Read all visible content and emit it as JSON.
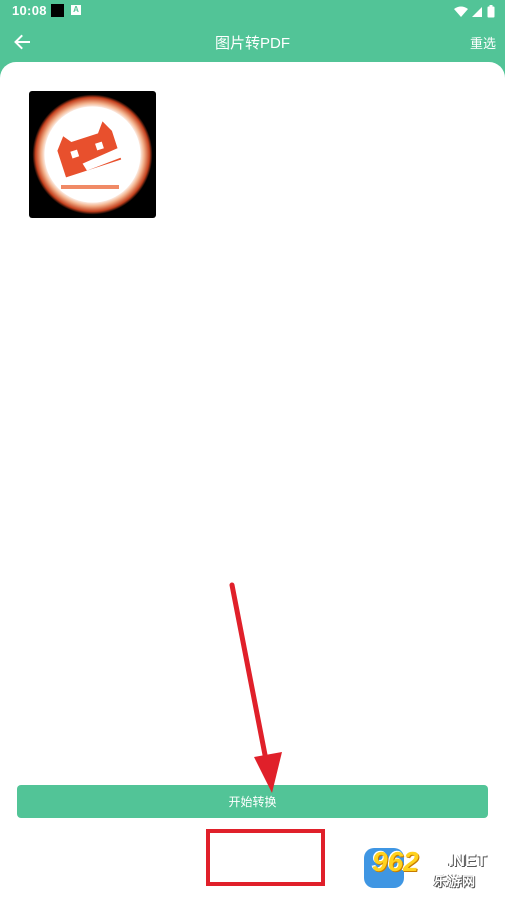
{
  "status_bar": {
    "time": "10:08",
    "notification_label": "A",
    "icons": [
      "notification-black-icon",
      "notification-a-icon",
      "wifi-icon",
      "signal-icon",
      "battery-icon"
    ]
  },
  "toolbar": {
    "back_icon": "arrow-left-icon",
    "title": "图片转PDF",
    "reselect_label": "重选"
  },
  "images": [
    {
      "name": "selected-image-1",
      "icon": "red-cat-logo"
    }
  ],
  "convert_button": {
    "label": "开始转换"
  },
  "watermark": {
    "number": "962",
    "suffix": ".NET",
    "subtitle": "乐游网"
  },
  "colors": {
    "primary": "#52c497",
    "background": "#ffffff",
    "annotation": "#e0202a",
    "logo_red": "#e8502d"
  }
}
